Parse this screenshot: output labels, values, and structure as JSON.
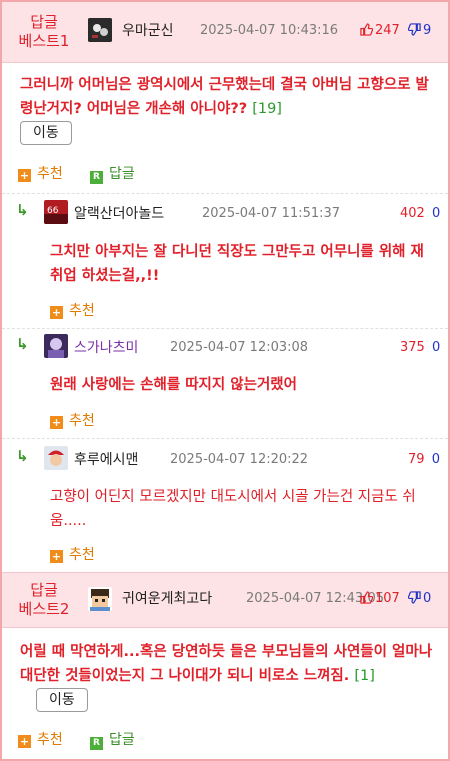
{
  "best1": {
    "label_line1": "답글",
    "label_line2": "베스트1",
    "author": "우마군신",
    "date": "2025-04-07 10:43:16",
    "up": "247",
    "down": "9",
    "body": "그러니까 어머님은 광역시에서 근무했는데 결국 아버님 고향으로 발령난거지? 어머님은 개손해 아니야??",
    "reply_count": "[19]",
    "move_label": "이동",
    "recommend_label": "추천",
    "reply_label": "답글"
  },
  "replies": [
    {
      "author": "알랙산더아놀드",
      "date": "2025-04-07 11:51:37",
      "up": "402",
      "down": "0",
      "body": "그치만 아부지는 잘 다니던 직장도 그만두고 어무니를 위해 재취업 하셨는걸,,!!",
      "recommend_label": "추천"
    },
    {
      "author": "스가나츠미",
      "date": "2025-04-07 12:03:08",
      "up": "375",
      "down": "0",
      "body": "원래 사랑에는 손해를 따지지 않는거랬어",
      "recommend_label": "추천"
    },
    {
      "author": "후루에시맨",
      "date": "2025-04-07 12:20:22",
      "up": "79",
      "down": "0",
      "body": "고향이 어딘지 모르겠지만 대도시에서 시골 가는건 지금도 쉬움.....",
      "recommend_label": "추천"
    }
  ],
  "best2": {
    "label_line1": "답글",
    "label_line2": "베스트2",
    "author": "귀여운게최고다",
    "date": "2025-04-07 12:43:05",
    "up": "107",
    "down": "0",
    "body": "어릴 때 막연하게...혹은 당연하듯 들은 부모님들의 사연들이 얼마나 대단한 것들이었는지 그 나이대가 되니 비로소 느껴짐.",
    "reply_count": "[1]",
    "move_label": "이동",
    "recommend_label": "추천",
    "reply_label": "답글"
  },
  "colors": {
    "accent_red": "#e0212a",
    "down_blue": "#1f33c8",
    "header_pink": "#fde3e5",
    "frame_pink": "#f4a7ab"
  },
  "icons": {
    "thumb_up": "thumb-up-icon",
    "thumb_down": "thumb-down-icon",
    "reply_arrow": "reply-arrow-icon",
    "recommend": "plus-square-icon",
    "reply": "r-square-icon"
  }
}
